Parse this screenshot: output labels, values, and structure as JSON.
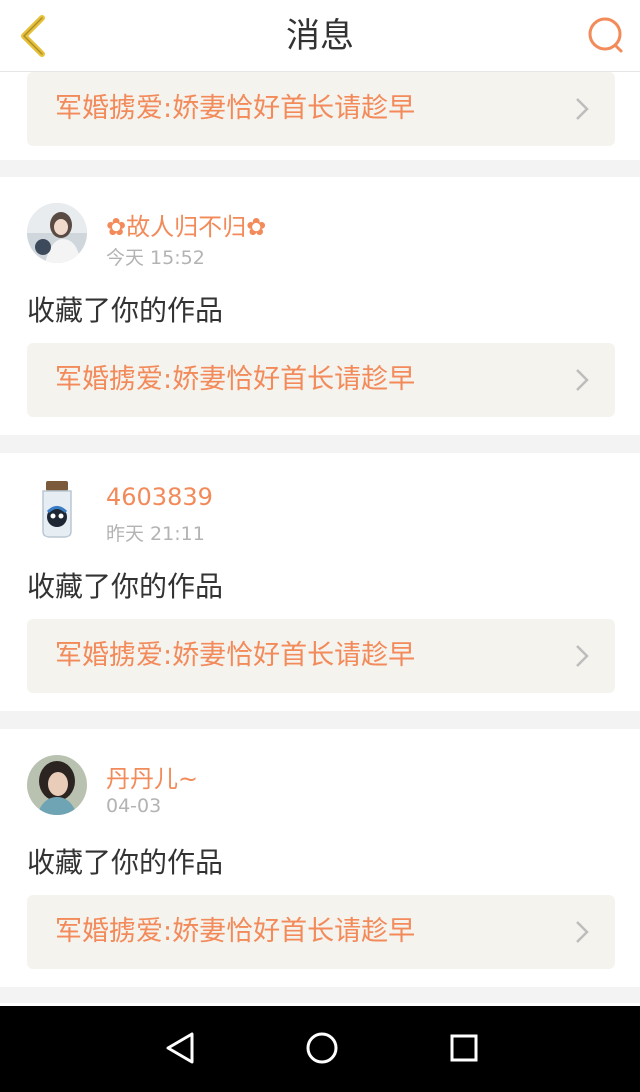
{
  "header": {
    "title": "消息",
    "back_icon": "chevron-left-icon",
    "search_icon": "search-icon"
  },
  "colors": {
    "accent": "#f28a5a",
    "back_icon": "#e8c13a"
  },
  "messages": [
    {
      "work_title": "军婚掳爱:娇妻恰好首长请趁早"
    },
    {
      "username": "✿故人归不归✿",
      "time": "今天 15:52",
      "action": "收藏了你的作品",
      "work_title": "军婚掳爱:娇妻恰好首长请趁早"
    },
    {
      "username": "4603839",
      "time": "昨天 21:11",
      "action": "收藏了你的作品",
      "work_title": "军婚掳爱:娇妻恰好首长请趁早"
    },
    {
      "username": "丹丹儿~",
      "time": "04-03",
      "action": "收藏了你的作品",
      "work_title": "军婚掳爱:娇妻恰好首长请趁早"
    }
  ],
  "navbar": {
    "back": "triangle-back-icon",
    "home": "circle-home-icon",
    "recents": "square-recents-icon"
  }
}
